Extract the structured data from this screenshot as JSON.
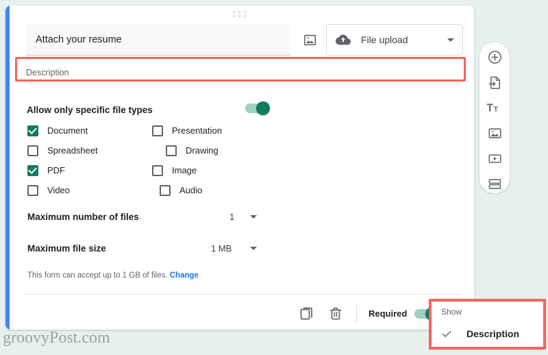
{
  "card": {
    "accent_color": "#4285f4",
    "drag_handle_icon": "drag-dots-icon",
    "title_value": "Attach your resume",
    "title_image_icon": "add-image-icon",
    "question_type": {
      "icon": "cloud-upload-icon",
      "label": "File upload",
      "caret_icon": "chevron-down-icon"
    },
    "description_placeholder": "Description",
    "allow_specific": {
      "label": "Allow only specific file types",
      "toggle_on": true,
      "toggle_color": "#0f7b5f"
    },
    "file_types": [
      {
        "label": "Document",
        "checked": true
      },
      {
        "label": "Presentation",
        "checked": false
      },
      {
        "label": "Spreadsheet",
        "checked": false
      },
      {
        "label": "Drawing",
        "checked": false
      },
      {
        "label": "PDF",
        "checked": true
      },
      {
        "label": "Image",
        "checked": false
      },
      {
        "label": "Video",
        "checked": false
      },
      {
        "label": "Audio",
        "checked": false
      }
    ],
    "max_files": {
      "label": "Maximum number of files",
      "value": "1"
    },
    "max_size": {
      "label": "Maximum file size",
      "value": "1 MB"
    },
    "accept_note": {
      "text": "This form can accept up to 1 GB of files.",
      "link_label": "Change"
    },
    "footer": {
      "duplicate_icon": "duplicate-icon",
      "delete_icon": "trash-icon",
      "required_label": "Required",
      "required_toggle_on": true,
      "more_options_icon": "more-options-icon"
    }
  },
  "sidebar": {
    "items": [
      {
        "icon": "add-circle-icon",
        "name": "add-question"
      },
      {
        "icon": "import-questions-icon",
        "name": "import-questions"
      },
      {
        "icon": "title-text-icon",
        "name": "add-title-and-description"
      },
      {
        "icon": "add-image-icon",
        "name": "add-image"
      },
      {
        "icon": "add-video-icon",
        "name": "add-video"
      },
      {
        "icon": "add-section-icon",
        "name": "add-section"
      }
    ]
  },
  "popup": {
    "title": "Show",
    "item_label": "Description",
    "item_checked": true,
    "check_icon": "check-icon"
  },
  "highlights": {
    "color": "#f4645a"
  },
  "watermark": "groovyPost.com"
}
